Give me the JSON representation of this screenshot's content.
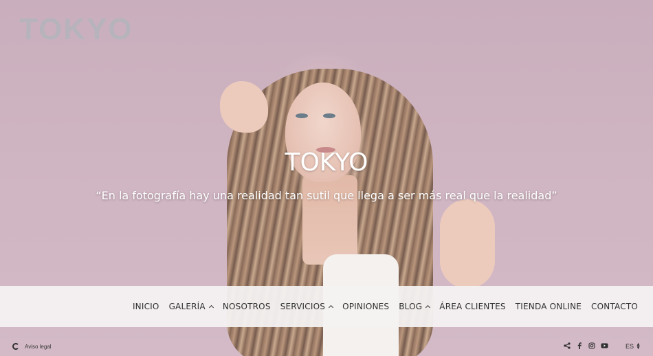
{
  "brand": {
    "logo_text": "TOKYO"
  },
  "hero": {
    "title": "TOKYO",
    "quote": "“En la fotografía hay una realidad tan sutil que llega a ser más real que la realidad”"
  },
  "nav": {
    "items": [
      {
        "label": "INICIO",
        "has_submenu": false
      },
      {
        "label": "GALERÍA",
        "has_submenu": true
      },
      {
        "label": "NOSOTROS",
        "has_submenu": false
      },
      {
        "label": "SERVICIOS",
        "has_submenu": true
      },
      {
        "label": "OPINIONES",
        "has_submenu": false
      },
      {
        "label": "BLOG",
        "has_submenu": true
      },
      {
        "label": "ÁREA CLIENTES",
        "has_submenu": false
      },
      {
        "label": "TIENDA ONLINE",
        "has_submenu": false
      },
      {
        "label": "CONTACTO",
        "has_submenu": false
      }
    ]
  },
  "footer": {
    "legal_label": "Aviso legal",
    "social_icons": [
      "share-icon",
      "facebook-icon",
      "instagram-icon",
      "youtube-icon"
    ],
    "language": "ES"
  },
  "colors": {
    "text_dark": "#2f2f2f",
    "nav_bg": "#f4f2f2",
    "hero_text": "#ffffff"
  }
}
